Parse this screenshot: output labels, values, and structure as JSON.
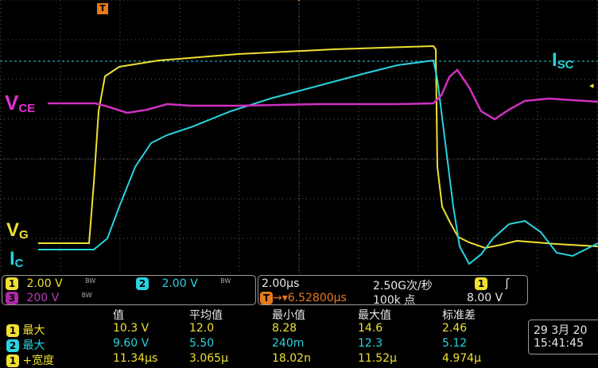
{
  "traces": {
    "vce_label": "V",
    "vce_sub": "CE",
    "isc_label": "I",
    "isc_sub": "SC",
    "vg_label": "V",
    "vg_sub": "G",
    "ic_label": "I",
    "ic_sub": "C",
    "trigger_marker": "T"
  },
  "colors": {
    "ch1": "#f0e030",
    "ch2": "#29d3e0",
    "ch3": "#c03ab8",
    "trigger": "#e87a1d",
    "grid": "#6a6a6a"
  },
  "channels": [
    {
      "num": "1",
      "scale": "2.00 V",
      "bw": "BW"
    },
    {
      "num": "2",
      "scale": "2.00 V",
      "bw": "BW"
    },
    {
      "num": "3",
      "scale": "200 V",
      "bw": "BW"
    }
  ],
  "timebase": {
    "scale": "2.00µs",
    "sample_rate": "2.50G次/秒",
    "trigger_pos": "▾6.52800µs",
    "record_length": "100k 点",
    "trigger_channel": "1",
    "trigger_slope": "ʃ",
    "trigger_level": "8.00 V"
  },
  "measurements": {
    "headers": [
      "值",
      "平均值",
      "最小值",
      "最大值",
      "标准差"
    ],
    "rows": [
      {
        "ch": "1",
        "name": "最大",
        "value": "10.3 V",
        "mean": "12.0",
        "min": "8.28",
        "max": "14.6",
        "std": "2.46"
      },
      {
        "ch": "2",
        "name": "最大",
        "value": "9.60 V",
        "mean": "5.50",
        "min": "240m",
        "max": "12.3",
        "std": "5.12"
      },
      {
        "ch": "1",
        "name": "+宽度",
        "value": "11.34µs",
        "mean": "3.065µ",
        "min": "18.02n",
        "max": "11.52µ",
        "std": "4.974µ"
      }
    ]
  },
  "datetime": {
    "date": "29 3月  20",
    "time": "15:41:45"
  }
}
